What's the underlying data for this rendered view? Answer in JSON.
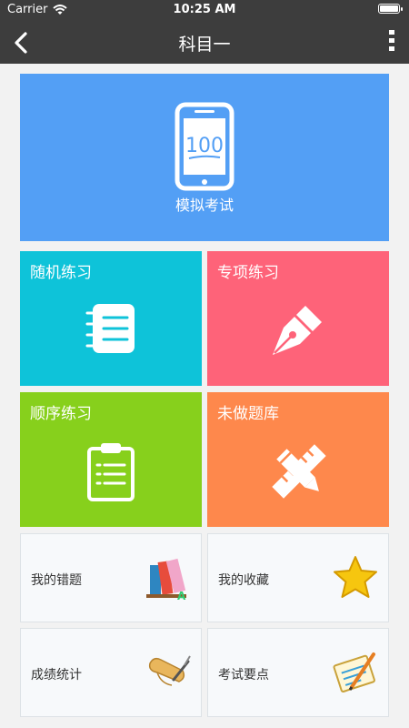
{
  "status_bar": {
    "carrier": "Carrier",
    "time": "10:25 AM"
  },
  "nav": {
    "title": "科目一",
    "back_icon": "chevron-left-icon",
    "more_icon": "more-vertical-icon"
  },
  "main_tile": {
    "label": "模拟考试",
    "icon": "phone-100-icon",
    "number": "100",
    "color": "#539ff5"
  },
  "tiles": [
    {
      "label": "随机练习",
      "icon": "notebook-icon",
      "color": "#0ec3d9"
    },
    {
      "label": "专项练习",
      "icon": "pen-nib-icon",
      "color": "#fe6379"
    },
    {
      "label": "顺序练习",
      "icon": "clipboard-icon",
      "color": "#87d01c"
    },
    {
      "label": "未做题库",
      "icon": "pencil-ruler-icon",
      "color": "#fe884c"
    }
  ],
  "cards": [
    {
      "label": "我的错题",
      "icon": "books-icon"
    },
    {
      "label": "我的收藏",
      "icon": "star-icon"
    },
    {
      "label": "成绩统计",
      "icon": "scroll-quill-icon"
    },
    {
      "label": "考试要点",
      "icon": "notepad-pen-icon"
    }
  ]
}
